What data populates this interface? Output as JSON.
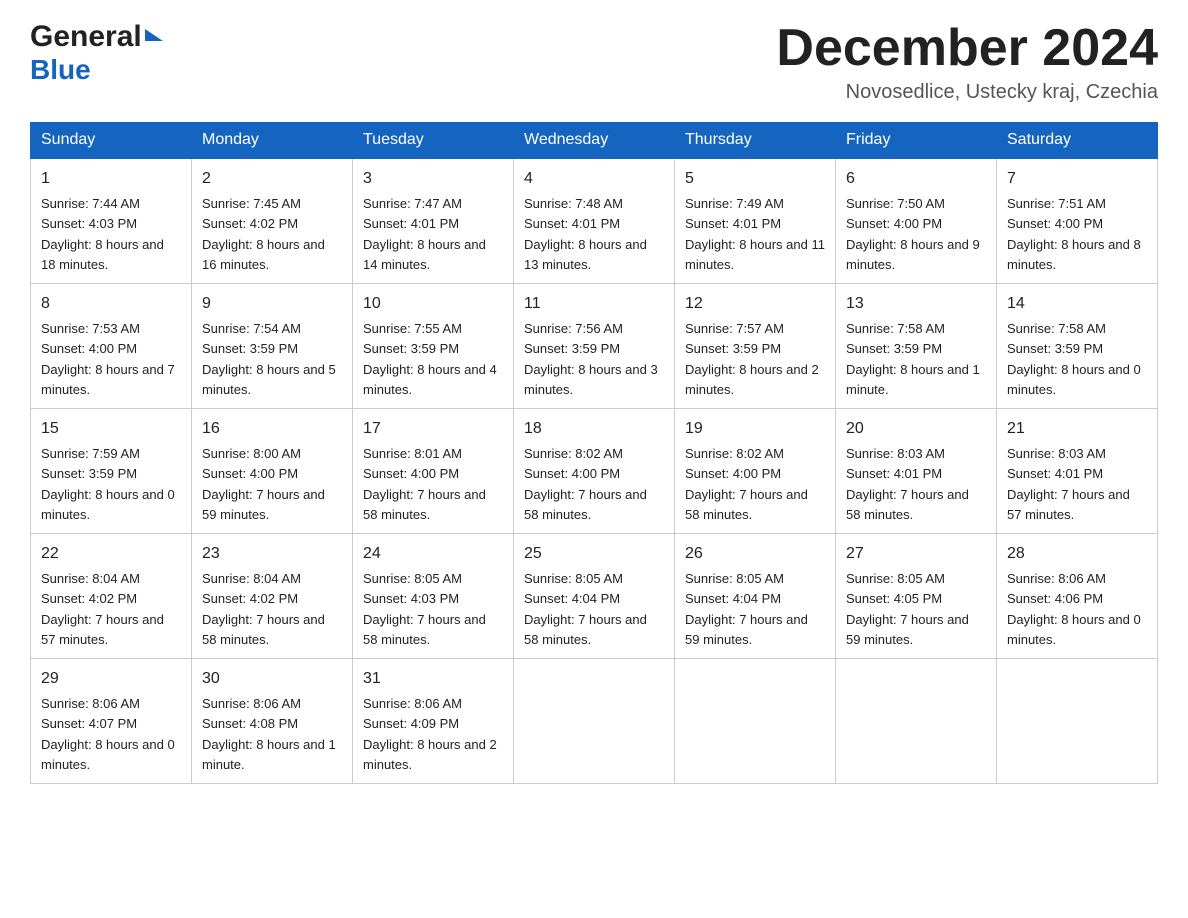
{
  "header": {
    "logo_general": "General",
    "logo_blue": "Blue",
    "month_title": "December 2024",
    "location": "Novosedlice, Ustecky kraj, Czechia"
  },
  "days_of_week": [
    "Sunday",
    "Monday",
    "Tuesday",
    "Wednesday",
    "Thursday",
    "Friday",
    "Saturday"
  ],
  "weeks": [
    [
      {
        "day": "1",
        "sunrise": "7:44 AM",
        "sunset": "4:03 PM",
        "daylight": "8 hours and 18 minutes."
      },
      {
        "day": "2",
        "sunrise": "7:45 AM",
        "sunset": "4:02 PM",
        "daylight": "8 hours and 16 minutes."
      },
      {
        "day": "3",
        "sunrise": "7:47 AM",
        "sunset": "4:01 PM",
        "daylight": "8 hours and 14 minutes."
      },
      {
        "day": "4",
        "sunrise": "7:48 AM",
        "sunset": "4:01 PM",
        "daylight": "8 hours and 13 minutes."
      },
      {
        "day": "5",
        "sunrise": "7:49 AM",
        "sunset": "4:01 PM",
        "daylight": "8 hours and 11 minutes."
      },
      {
        "day": "6",
        "sunrise": "7:50 AM",
        "sunset": "4:00 PM",
        "daylight": "8 hours and 9 minutes."
      },
      {
        "day": "7",
        "sunrise": "7:51 AM",
        "sunset": "4:00 PM",
        "daylight": "8 hours and 8 minutes."
      }
    ],
    [
      {
        "day": "8",
        "sunrise": "7:53 AM",
        "sunset": "4:00 PM",
        "daylight": "8 hours and 7 minutes."
      },
      {
        "day": "9",
        "sunrise": "7:54 AM",
        "sunset": "3:59 PM",
        "daylight": "8 hours and 5 minutes."
      },
      {
        "day": "10",
        "sunrise": "7:55 AM",
        "sunset": "3:59 PM",
        "daylight": "8 hours and 4 minutes."
      },
      {
        "day": "11",
        "sunrise": "7:56 AM",
        "sunset": "3:59 PM",
        "daylight": "8 hours and 3 minutes."
      },
      {
        "day": "12",
        "sunrise": "7:57 AM",
        "sunset": "3:59 PM",
        "daylight": "8 hours and 2 minutes."
      },
      {
        "day": "13",
        "sunrise": "7:58 AM",
        "sunset": "3:59 PM",
        "daylight": "8 hours and 1 minute."
      },
      {
        "day": "14",
        "sunrise": "7:58 AM",
        "sunset": "3:59 PM",
        "daylight": "8 hours and 0 minutes."
      }
    ],
    [
      {
        "day": "15",
        "sunrise": "7:59 AM",
        "sunset": "3:59 PM",
        "daylight": "8 hours and 0 minutes."
      },
      {
        "day": "16",
        "sunrise": "8:00 AM",
        "sunset": "4:00 PM",
        "daylight": "7 hours and 59 minutes."
      },
      {
        "day": "17",
        "sunrise": "8:01 AM",
        "sunset": "4:00 PM",
        "daylight": "7 hours and 58 minutes."
      },
      {
        "day": "18",
        "sunrise": "8:02 AM",
        "sunset": "4:00 PM",
        "daylight": "7 hours and 58 minutes."
      },
      {
        "day": "19",
        "sunrise": "8:02 AM",
        "sunset": "4:00 PM",
        "daylight": "7 hours and 58 minutes."
      },
      {
        "day": "20",
        "sunrise": "8:03 AM",
        "sunset": "4:01 PM",
        "daylight": "7 hours and 58 minutes."
      },
      {
        "day": "21",
        "sunrise": "8:03 AM",
        "sunset": "4:01 PM",
        "daylight": "7 hours and 57 minutes."
      }
    ],
    [
      {
        "day": "22",
        "sunrise": "8:04 AM",
        "sunset": "4:02 PM",
        "daylight": "7 hours and 57 minutes."
      },
      {
        "day": "23",
        "sunrise": "8:04 AM",
        "sunset": "4:02 PM",
        "daylight": "7 hours and 58 minutes."
      },
      {
        "day": "24",
        "sunrise": "8:05 AM",
        "sunset": "4:03 PM",
        "daylight": "7 hours and 58 minutes."
      },
      {
        "day": "25",
        "sunrise": "8:05 AM",
        "sunset": "4:04 PM",
        "daylight": "7 hours and 58 minutes."
      },
      {
        "day": "26",
        "sunrise": "8:05 AM",
        "sunset": "4:04 PM",
        "daylight": "7 hours and 59 minutes."
      },
      {
        "day": "27",
        "sunrise": "8:05 AM",
        "sunset": "4:05 PM",
        "daylight": "7 hours and 59 minutes."
      },
      {
        "day": "28",
        "sunrise": "8:06 AM",
        "sunset": "4:06 PM",
        "daylight": "8 hours and 0 minutes."
      }
    ],
    [
      {
        "day": "29",
        "sunrise": "8:06 AM",
        "sunset": "4:07 PM",
        "daylight": "8 hours and 0 minutes."
      },
      {
        "day": "30",
        "sunrise": "8:06 AM",
        "sunset": "4:08 PM",
        "daylight": "8 hours and 1 minute."
      },
      {
        "day": "31",
        "sunrise": "8:06 AM",
        "sunset": "4:09 PM",
        "daylight": "8 hours and 2 minutes."
      },
      null,
      null,
      null,
      null
    ]
  ],
  "labels": {
    "sunrise": "Sunrise:",
    "sunset": "Sunset:",
    "daylight": "Daylight:"
  }
}
